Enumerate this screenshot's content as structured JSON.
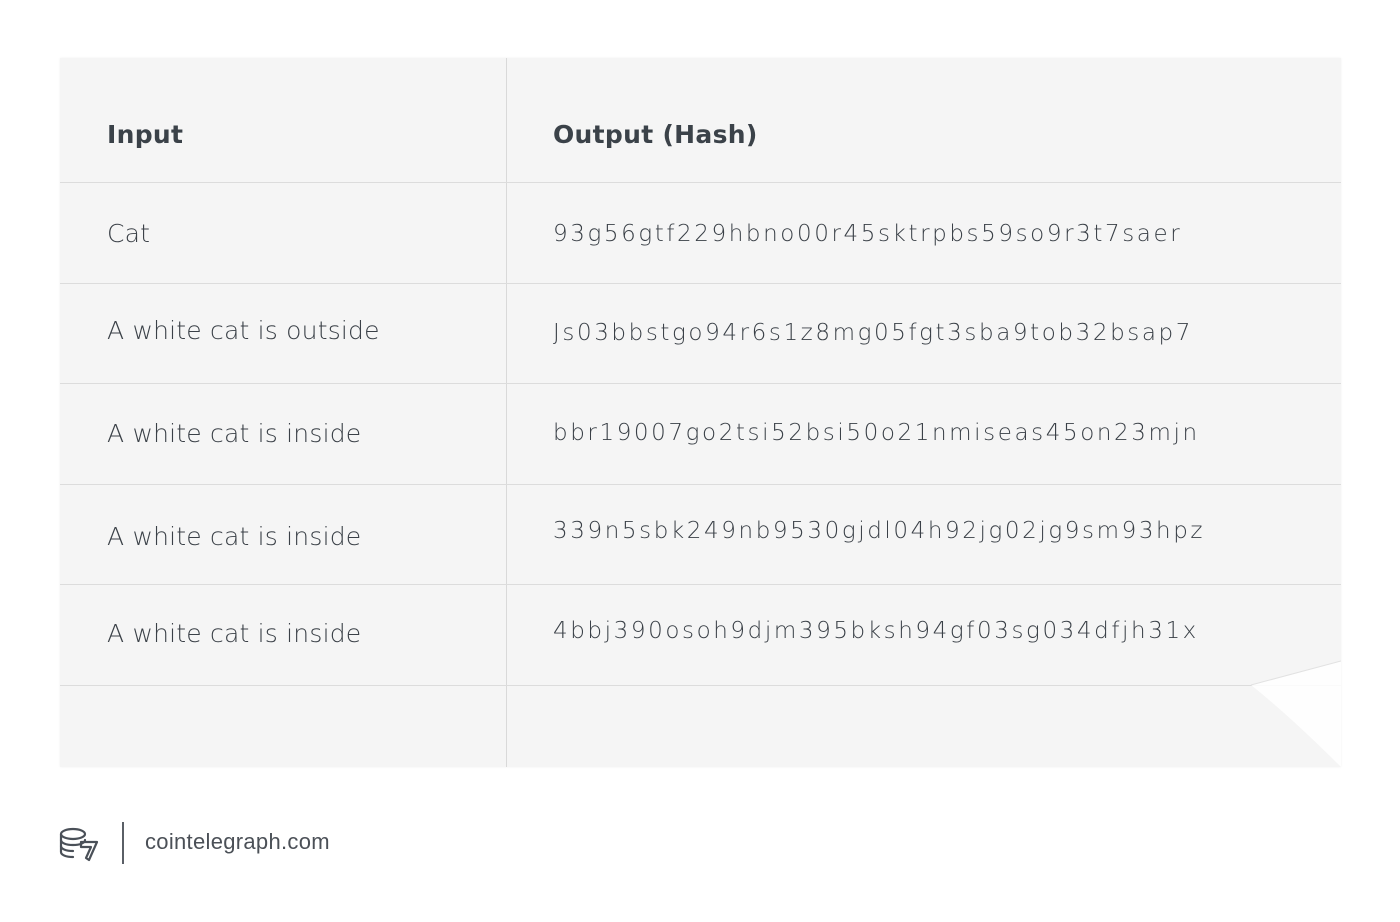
{
  "table": {
    "headers": {
      "input": "Input",
      "output": "Output (Hash)"
    },
    "rows": [
      {
        "input": "Cat",
        "hash": "93g56gtf229hbno00r45sktrpbs59so9r3t7saer"
      },
      {
        "input": "A white cat is outside",
        "hash": "Js03bbstgo94r6s1z8mg05fgt3sba9tob32bsap7"
      },
      {
        "input": "A white cat is inside",
        "hash": "bbr19007go2tsi52bsi50o21nmiseas45on23mjn"
      },
      {
        "input": "A white cat is inside",
        "hash": "339n5sbk249nb9530gjdl04h92jg02jg9sm93hpz"
      },
      {
        "input": "A white cat is inside",
        "hash": "4bbj390osoh9djm395bksh94gf03sg034dfjh31x"
      }
    ]
  },
  "footer": {
    "logo_icon": "cointelegraph-logo-icon",
    "site": "cointelegraph.com"
  },
  "colors": {
    "table_background": "#f5f5f5",
    "grid_lines": "#dcdcdc",
    "text": "#3a4047"
  }
}
